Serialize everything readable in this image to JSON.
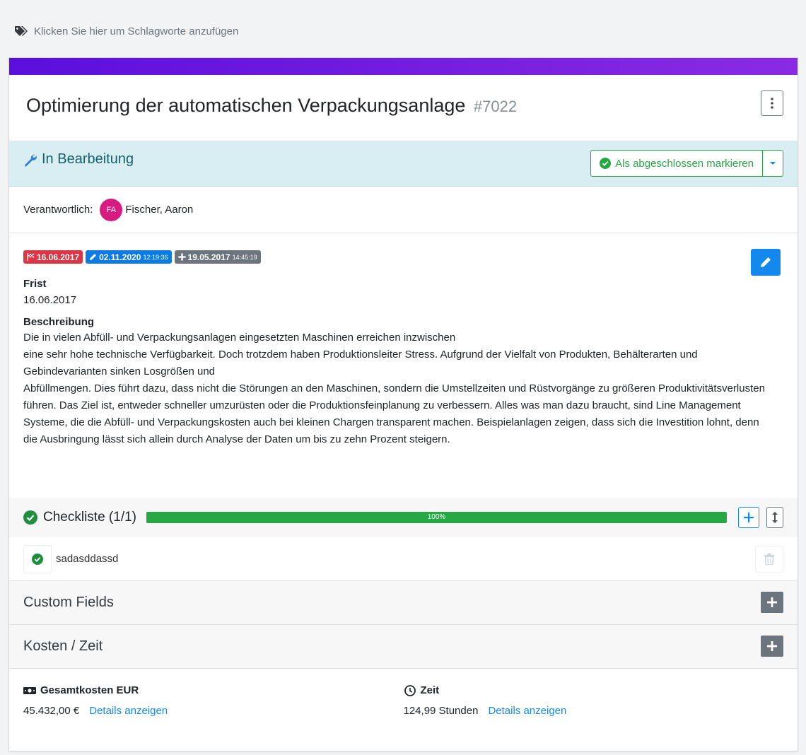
{
  "tags": {
    "placeholder_text": "Klicken Sie hier um Schlagworte anzufügen"
  },
  "task": {
    "title": "Optimierung der automatischen Verpackungsanlage",
    "number": "#7022"
  },
  "status": {
    "label": "In Bearbeitung",
    "complete_button": "Als abgeschlossen markieren"
  },
  "responsible": {
    "label": "Verantwortlich:",
    "initials": "FA",
    "name": "Fischer, Aaron"
  },
  "badges": {
    "deadline": "16.06.2017",
    "edited_date": "02.11.2020",
    "edited_time": "12:19:36",
    "created_date": "19.05.2017",
    "created_time": "14:45:19"
  },
  "deadline": {
    "label": "Frist",
    "value": "16.06.2017"
  },
  "description": {
    "label": "Beschreibung",
    "lines": [
      "Die in vielen Abfüll- und Verpackungsanlagen eingesetzten Maschinen erreichen inzwischen",
      "eine sehr hohe technische Verfügbarkeit. Doch trotzdem haben Produktionsleiter Stress. Aufgrund der Vielfalt von Produkten, Behälterarten und Gebindevarianten sinken Losgrößen und",
      "Abfüllmengen. Dies führt dazu, dass nicht die Störungen an den Maschinen, sondern die Umstellzeiten und Rüstvorgänge zu größeren Produktivitätsverlusten führen. Das Ziel ist, entweder schneller umzurüsten oder die Produktionsfeinplanung zu verbessern. Alles was man dazu braucht, sind Line Management Systeme, die die Abfüll- und Verpackungskosten auch bei kleinen Chargen transparent machen. Beispielanlagen zeigen, dass sich die Investition lohnt, denn",
      "die Ausbringung lässt sich allein durch Analyse der Daten um bis zu zehn Prozent steigern."
    ]
  },
  "checklist": {
    "title": "Checkliste (1/1)",
    "progress_percent": 100,
    "progress_label": "100%",
    "items": [
      {
        "text": "sadasddassd",
        "done": true
      }
    ]
  },
  "custom_fields": {
    "title": "Custom Fields"
  },
  "costs_time": {
    "title": "Kosten / Zeit",
    "total_cost_label": "Gesamtkosten EUR",
    "total_cost_value": "45.432,00 €",
    "time_label": "Zeit",
    "time_value": "124,99 Stunden",
    "details_link": "Details anzeigen"
  },
  "colors": {
    "accent_start": "#5b0fdc",
    "accent_end": "#8a2be2",
    "success": "#28a745",
    "primary": "#1389ef",
    "danger": "#dc3545"
  },
  "icons": {
    "tags": "tags-icon",
    "status": "wrench-icon",
    "complete": "check-circle-icon",
    "deadline": "flag-checkered-icon",
    "edited": "pencil-icon",
    "created": "plus-icon",
    "costs": "money-bill-icon",
    "time": "clock-icon"
  }
}
